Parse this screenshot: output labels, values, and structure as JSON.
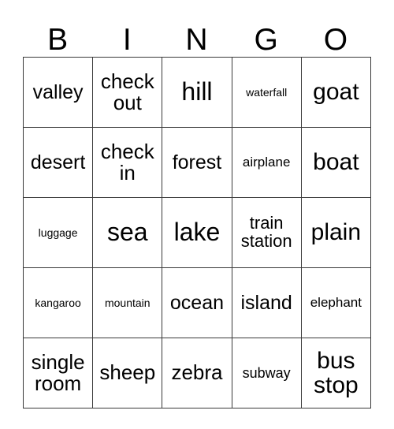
{
  "card": {
    "header": {
      "letters": [
        "B",
        "I",
        "N",
        "G",
        "O"
      ]
    },
    "rows": [
      {
        "cells": [
          {
            "text": "valley",
            "size": "fs-ml"
          },
          {
            "text": "check\nout",
            "size": "fs-l"
          },
          {
            "text": "hill",
            "size": "fs-xxl"
          },
          {
            "text": "waterfall",
            "size": "fs-xs"
          },
          {
            "text": "goat",
            "size": "fs-xl"
          }
        ]
      },
      {
        "cells": [
          {
            "text": "desert",
            "size": "fs-ml"
          },
          {
            "text": "check\nin",
            "size": "fs-l"
          },
          {
            "text": "forest",
            "size": "fs-ml"
          },
          {
            "text": "airplane",
            "size": "fs-s"
          },
          {
            "text": "boat",
            "size": "fs-xl"
          }
        ]
      },
      {
        "cells": [
          {
            "text": "luggage",
            "size": "fs-xs"
          },
          {
            "text": "sea",
            "size": "fs-xxl"
          },
          {
            "text": "lake",
            "size": "fs-xxl"
          },
          {
            "text": "train\nstation",
            "size": "fs-m"
          },
          {
            "text": "plain",
            "size": "fs-xl"
          }
        ]
      },
      {
        "cells": [
          {
            "text": "kangaroo",
            "size": "fs-xs"
          },
          {
            "text": "mountain",
            "size": "fs-xs"
          },
          {
            "text": "ocean",
            "size": "fs-ml"
          },
          {
            "text": "island",
            "size": "fs-ml"
          },
          {
            "text": "elephant",
            "size": "fs-s"
          }
        ]
      },
      {
        "cells": [
          {
            "text": "single\nroom",
            "size": "fs-l"
          },
          {
            "text": "sheep",
            "size": "fs-l"
          },
          {
            "text": "zebra",
            "size": "fs-l"
          },
          {
            "text": "subway",
            "size": "fs-sm"
          },
          {
            "text": "bus\nstop",
            "size": "fs-xl"
          }
        ]
      }
    ]
  },
  "colors": {
    "background": "#ffffff",
    "text": "#000000",
    "grid_line": "#3a3a3a"
  }
}
